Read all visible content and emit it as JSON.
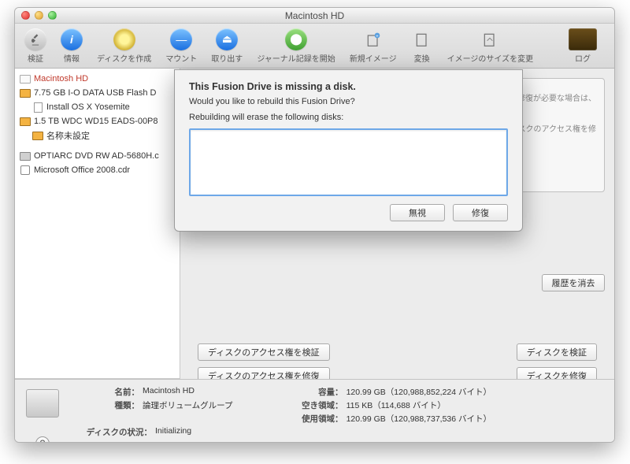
{
  "window": {
    "title": "Macintosh HD"
  },
  "toolbar": {
    "items": [
      {
        "label": "検証",
        "kind": "gray"
      },
      {
        "label": "情報",
        "kind": "blue"
      },
      {
        "label": "ディスクを作成",
        "kind": "yellow"
      },
      {
        "label": "マウント",
        "kind": "blue"
      },
      {
        "label": "取り出す",
        "kind": "blue"
      },
      {
        "label": "ジャーナル記録を開始",
        "kind": "green"
      },
      {
        "label": "新規イメージ",
        "kind": "none"
      },
      {
        "label": "変換",
        "kind": "none"
      },
      {
        "label": "イメージのサイズを変更",
        "kind": "none"
      }
    ],
    "log_label": "ログ"
  },
  "sidebar": [
    {
      "label": "Macintosh HD",
      "icon": "hd-white",
      "selected": true,
      "level": 0
    },
    {
      "label": "7.75 GB I-O DATA USB Flash D",
      "icon": "hd-orange",
      "level": 0
    },
    {
      "label": "Install OS X Yosemite",
      "icon": "doc",
      "level": 1
    },
    {
      "label": "1.5 TB WDC WD15 EADS-00P8",
      "icon": "hd-orange",
      "level": 0
    },
    {
      "label": "名称未設定",
      "icon": "hd-orange",
      "level": 1
    },
    {
      "label": "OPTIARC DVD RW AD-5680H.c",
      "icon": "hd-gray",
      "level": 0
    },
    {
      "label": "Microsoft Office 2008.cdr",
      "icon": "dmg",
      "level": 0
    }
  ],
  "main": {
    "background_hint_1": "ディスクの修復が必要な場合は、",
    "background_hint_2": "場合は、\"ディスクのアクセス権を修",
    "clear_history": "履歴を消去",
    "verify_perm": "ディスクのアクセス権を検証",
    "repair_perm": "ディスクのアクセス権を修復",
    "verify_disk": "ディスクを検証",
    "repair_disk": "ディスクを修復"
  },
  "dialog": {
    "title": "This Fusion Drive is missing a disk.",
    "question": "Would you like to rebuild this Fusion Drive?",
    "warning": "Rebuilding will erase the following disks:",
    "ignore": "無視",
    "repair": "修復"
  },
  "footer": {
    "name_label": "名前：",
    "name_value": "Macintosh HD",
    "type_label": "種類：",
    "type_value": "論理ボリュームグループ",
    "status_label": "ディスクの状況：",
    "status_value": "Initializing",
    "capacity_label": "容量：",
    "capacity_value": "120.99 GB（120,988,852,224 バイト）",
    "free_label": "空き領域：",
    "free_value": "115 KB（114,688 バイト）",
    "used_label": "使用領域：",
    "used_value": "120.99 GB（120,988,737,536 バイト）"
  }
}
